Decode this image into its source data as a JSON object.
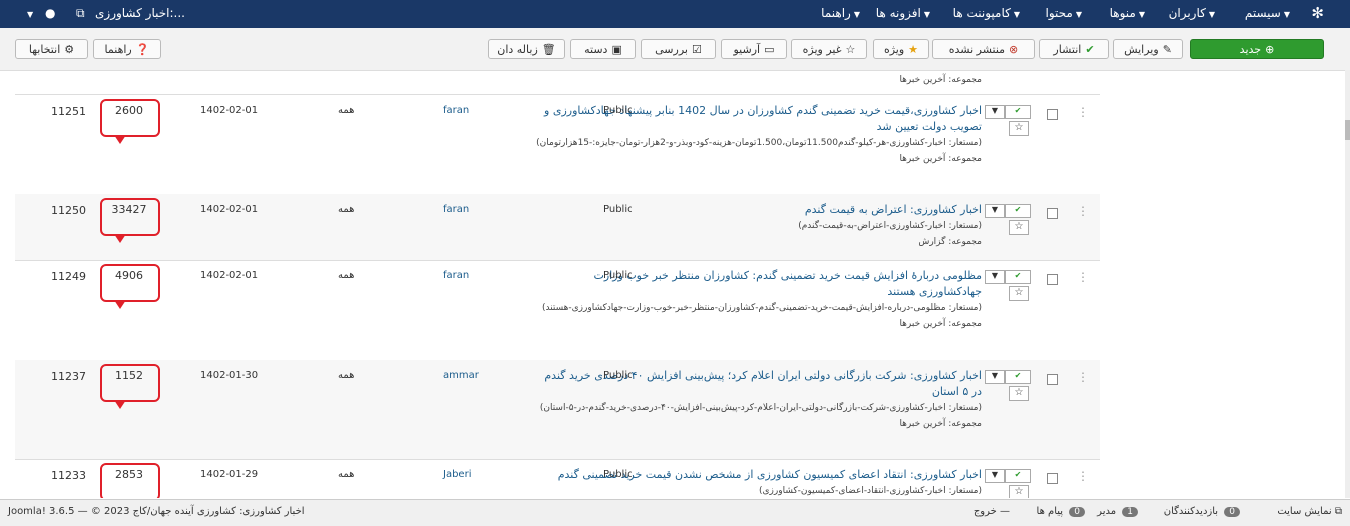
{
  "navbar": {
    "menus": [
      "سیستم",
      "کاربران",
      "منوها",
      "محتوا",
      "کامپوننت ها",
      "افزونه ها",
      "راهنما"
    ],
    "site_name": "اخبار کشاورزی:..."
  },
  "toolbar": {
    "new": "جدید",
    "edit": "ویرایش",
    "publish": "انتشار",
    "unpublish": "منتشر نشده",
    "featured": "ویژه",
    "unfeatured": "غیر ویژه",
    "archive": "آرشیو",
    "checkin": "بررسی",
    "batch": "دسته",
    "trash": "زباله دان",
    "help": "راهنما",
    "options": "انتخابها"
  },
  "top_category": "مجموعه: آخرین خبرها",
  "rows": [
    {
      "title": "اخبار کشاورزی،قیمت خرید تضمینی گندم کشاورزان در سال 1402 بنابر پیشنهاد جهادکشاورزی و تصویب دولت تعیین شد",
      "alias": "(مستعار: اخبار-کشاورزی-هر-کیلو-گندم11.500تومان،1.500تومان-هزینه-کود-وبذر-و-2هزار-تومان-جایزه:-15هزارتومان)",
      "category": "مجموعه: آخرین خبرها",
      "access": "Public",
      "author": "faran",
      "language": "همه",
      "date": "1402-02-01",
      "hits": "2600",
      "id": "11251"
    },
    {
      "title": "اخبار کشاورزی: اعتراض به قیمت گندم",
      "alias": "(مستعار: اخبار-کشاورزی-اعتراض-به-قیمت-گندم)",
      "category": "مجموعه: گزارش",
      "access": "Public",
      "author": "faran",
      "language": "همه",
      "date": "1402-02-01",
      "hits": "33427",
      "id": "11250"
    },
    {
      "title": "مظلومی دربارهٔ افزایش قیمت خرید تضمینی گندم: کشاورزان منتظر خبر خوب وزارت جهادکشاورزی هستند",
      "alias": "(مستعار: مظلومی-درباره-افزایش-قیمت-خرید-تضمینی-گندم-کشاورزان-منتظر-خبر-خوب-وزارت-جهادکشاورزی-هستند)",
      "category": "مجموعه: آخرین خبرها",
      "access": "Public",
      "author": "faran",
      "language": "همه",
      "date": "1402-02-01",
      "hits": "4906",
      "id": "11249"
    },
    {
      "title": "اخبار کشاورزی: شرکت بازرگانی دولتی ایران اعلام کرد؛ پیش‌بینی افزایش ۴۰ درصدی خرید گندم در ۵ استان",
      "alias": "(مستعار: اخبار-کشاورزی-شرکت-بازرگانی-دولتی-ایران-اعلام-کرد-پیش‌بینی-افزایش-۴۰-درصدی-خرید-گندم-در-۵-استان)",
      "category": "مجموعه: آخرین خبرها",
      "access": "Public",
      "author": "ammar",
      "language": "همه",
      "date": "1402-01-30",
      "hits": "1152",
      "id": "11237"
    },
    {
      "title": "اخبار کشاورزی: انتقاد اعضای کمیسیون کشاورزی از مشخص نشدن قیمت خرید تضمینی گندم",
      "alias": "(مستعار: اخبار-کشاورزی-انتقاد-اعضای-کمیسیون-کشاورزی)",
      "category": "",
      "access": "Public",
      "author": "Jaberi",
      "language": "همه",
      "date": "1402-01-29",
      "hits": "2853",
      "id": "11233"
    }
  ],
  "footer": {
    "view_site": "نمایش سایت",
    "visitors_count": "0",
    "visitors": "بازدیدکنندگان",
    "admins_count": "1",
    "admins": "مدیر",
    "messages_count": "0",
    "messages": "پیام ها",
    "logout": "خروج",
    "copyright": "اخبار کشاورزی: کشاورزی آینده جهان/کاج Joomla! 3.6.5 — © 2023"
  },
  "colors": {
    "navbar": "#1a3867",
    "new_button": "#2f9b2f",
    "title_link": "#1d5d8c",
    "highlight": "#e0202a"
  }
}
